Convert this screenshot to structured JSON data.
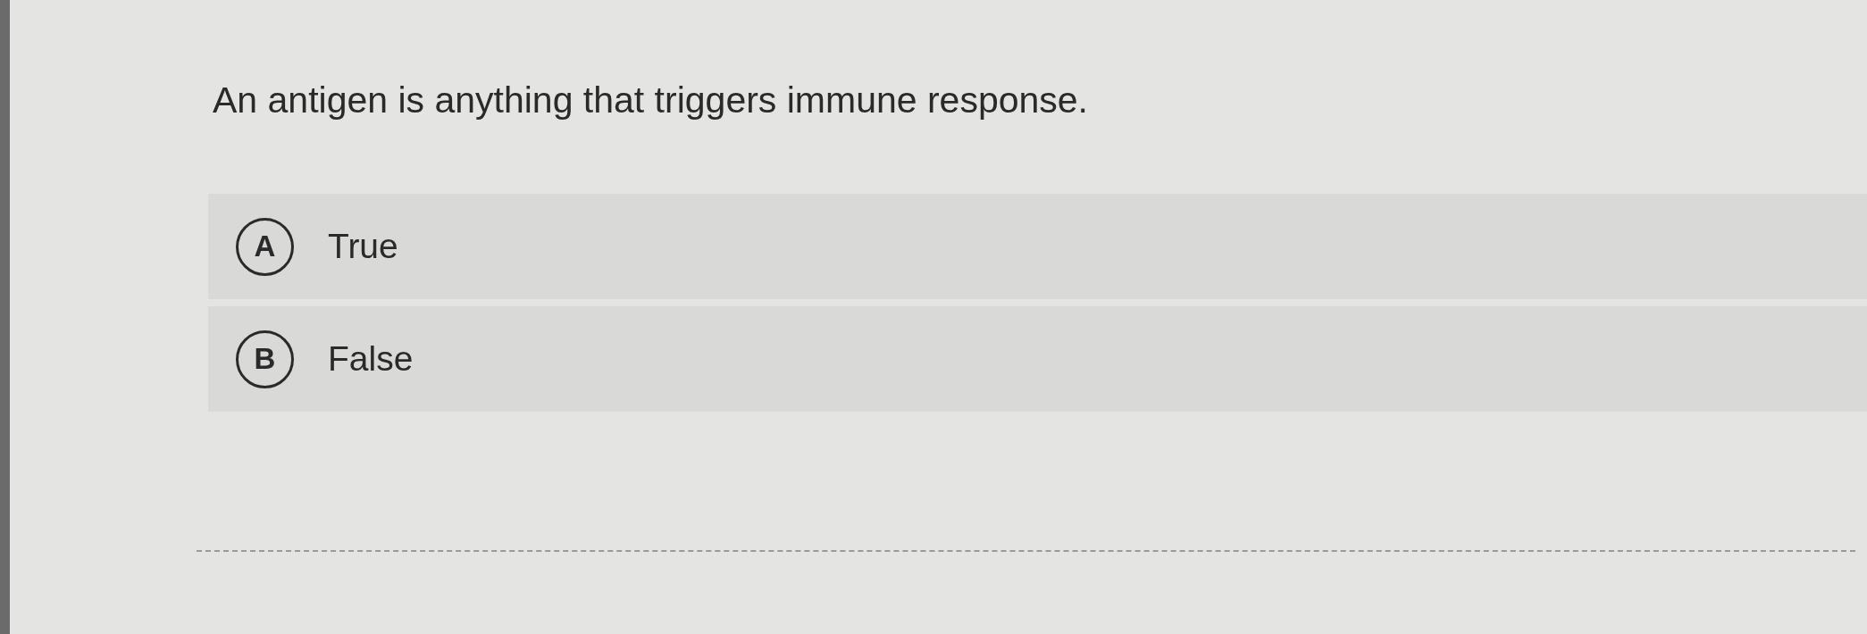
{
  "question": {
    "text": "An antigen is anything that triggers immune response."
  },
  "options": [
    {
      "letter": "A",
      "text": "True",
      "selected": false
    },
    {
      "letter": "B",
      "text": "False",
      "selected": false
    }
  ]
}
